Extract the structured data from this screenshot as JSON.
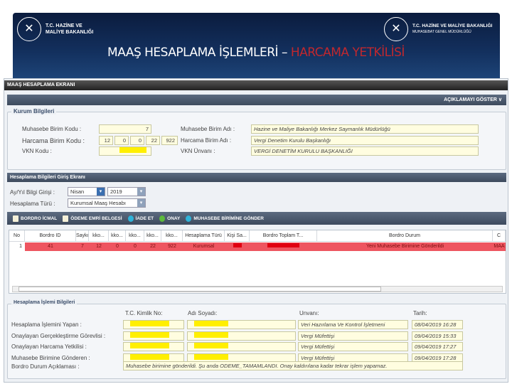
{
  "banner": {
    "logo_left": {
      "line1": "T.C. HAZİNE VE",
      "line2": "MALİYE BAKANLIĞI",
      "icon": "ministry-seal-icon"
    },
    "logo_right": {
      "line1": "T.C. HAZİNE VE MALİYE BAKANLIĞI",
      "line2": "MUHASEBAT GENEL MÜDÜRLÜĞÜ",
      "icon": "ministry-seal-icon"
    },
    "title_main": "MAAŞ HESAPLAMA İŞLEMLERİ –",
    "title_highlight": "HARCAMA YETKİLİSİ",
    "highlight_color": "#c0282e"
  },
  "screen": {
    "header": "MAAŞ HESAPLAMA EKRANI",
    "toggle_label": "AÇIKLAMAYI GÖSTER",
    "kurum": {
      "legend": "Kurum Bilgileri",
      "muhasebe_kodu_label": "Muhasebe Birim Kodu :",
      "muhasebe_kodu": "7",
      "harcama_kodu_label": "Harcama Birim Kodu :",
      "harcama_kodu": [
        "12",
        "0",
        "0",
        "22",
        "922"
      ],
      "vkn_label": "VKN Kodu :",
      "muhasebe_adi_label": "Muhasebe Birim Adı :",
      "muhasebe_adi": "Hazine ve Maliye Bakanlığı Merkez Saymanlık Müdürlüğü",
      "harcama_adi_label": "Harcama Birim Adı :",
      "harcama_adi": "Vergi Denetim Kurulu Başkanlığı",
      "vkn_unvan_label": "VKN Ünvanı :",
      "vkn_unvan": "VERGİ DENETİM KURULU BAŞKANLIĞI"
    },
    "hesaplama": {
      "header": "Hesaplama Bilgileri Giriş Ekranı",
      "ay_yil_label": "Ay/Yıl Bilgi Girişi :",
      "ay": "Nisan",
      "yil": "2019",
      "tur_label": "Hesaplama Türü :",
      "tur": "Kurumsal Maaş Hesabı",
      "toolbar": [
        "BORDRO İCMAL",
        "ÖDEME EMRİ BELGESİ",
        "İADE ET",
        "ONAY",
        "MUHASEBE BİRİMİNE GÖNDER"
      ],
      "table": {
        "columns": [
          "No",
          "Bordro ID",
          "Saykod",
          "kko...",
          "kko...",
          "kko...",
          "kko...",
          "kko...",
          "Hesaplama Türü",
          "Kişi Sa...",
          "Bordro Toplam T...",
          "Bordro Durum",
          "C"
        ],
        "rows": [
          [
            "1",
            "41",
            "7",
            "12",
            "0",
            "0",
            "22",
            "922",
            "Kurumsal",
            "",
            "",
            "Yeni Muhasebe Birimine Gönderildi",
            "MAA"
          ]
        ],
        "row_color": "#ee5560"
      }
    },
    "islem": {
      "legend": "Hesaplama İşlemi Bilgileri",
      "col_tc": "T.C. Kimlik No:",
      "col_ad": "Adı Soyadı:",
      "col_unvan": "Unvanı:",
      "col_tarih": "Tarih:",
      "rows": [
        {
          "label": "Hesaplama İşlemini Yapan :",
          "unvan": "Veri Hazırlama Ve Kontrol İşletmeni",
          "tarih": "08/04/2019 16:28"
        },
        {
          "label": "Onaylayan Gerçekleştirme Görevlisi :",
          "unvan": "Vergi Müfettişi",
          "tarih": "09/04/2019 15:33"
        },
        {
          "label": "Onaylayan Harcama Yetkilisi :",
          "unvan": "Vergi Müfettişi",
          "tarih": "09/04/2019 17:27"
        },
        {
          "label": "Muhasebe Birimine Gönderen :",
          "unvan": "Vergi Müfettişi",
          "tarih": "09/04/2019 17:28"
        }
      ],
      "durum_label": "Bordro Durum Açıklaması :",
      "durum": "Muhasebe birimine gönderildi. Şu anda ODEME_TAMAMLANDI. Onay kaldırılana kadar tekrar işlem yapamaz."
    }
  }
}
